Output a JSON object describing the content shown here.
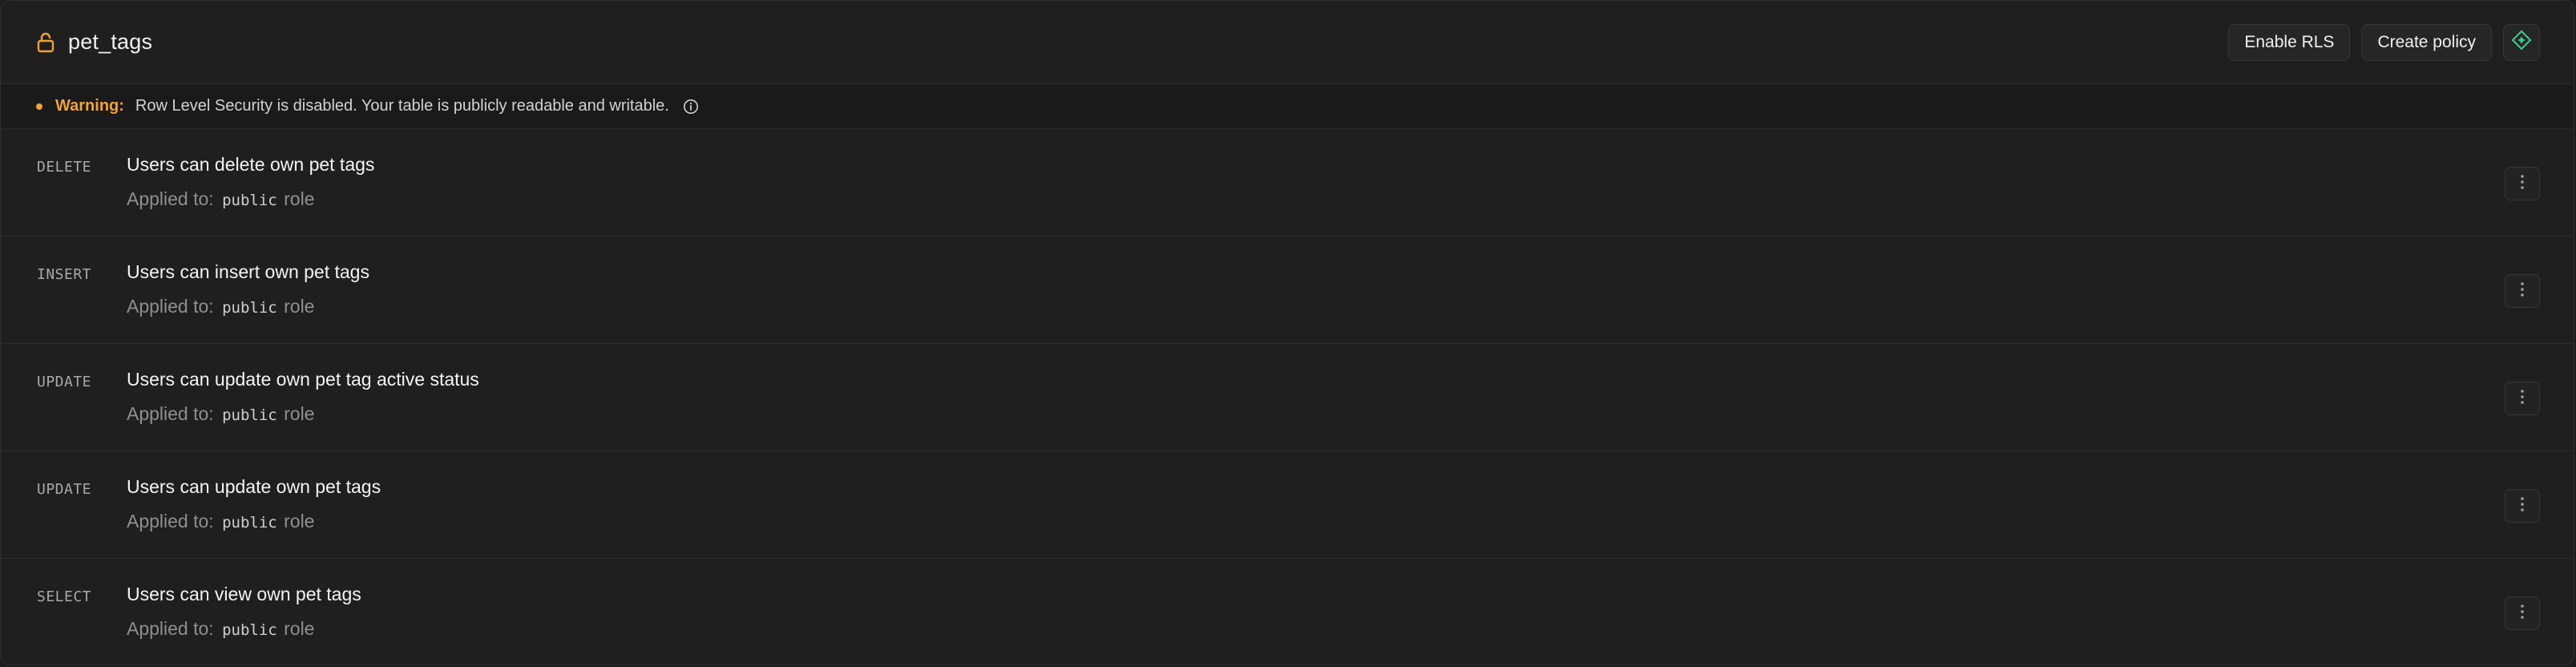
{
  "header": {
    "table_name": "pet_tags",
    "lock_icon": "unlocked-lock-icon",
    "enable_rls_label": "Enable RLS",
    "create_policy_label": "Create policy",
    "ai_assistant_icon": "diamond-sparkle-icon"
  },
  "warning": {
    "label": "Warning:",
    "text": "Row Level Security is disabled. Your table is publicly readable and writable.",
    "icon": "info-icon"
  },
  "policies": [
    {
      "command": "DELETE",
      "name": "Users can delete own pet tags",
      "applied_prefix": "Applied to:",
      "role": "public",
      "role_suffix": "role"
    },
    {
      "command": "INSERT",
      "name": "Users can insert own pet tags",
      "applied_prefix": "Applied to:",
      "role": "public",
      "role_suffix": "role"
    },
    {
      "command": "UPDATE",
      "name": "Users can update own pet tag active status",
      "applied_prefix": "Applied to:",
      "role": "public",
      "role_suffix": "role"
    },
    {
      "command": "UPDATE",
      "name": "Users can update own pet tags",
      "applied_prefix": "Applied to:",
      "role": "public",
      "role_suffix": "role"
    },
    {
      "command": "SELECT",
      "name": "Users can view own pet tags",
      "applied_prefix": "Applied to:",
      "role": "public",
      "role_suffix": "role"
    }
  ],
  "colors": {
    "warning": "#f0a330",
    "accent_green": "#3ecf8e",
    "background": "#1f1f1f"
  }
}
